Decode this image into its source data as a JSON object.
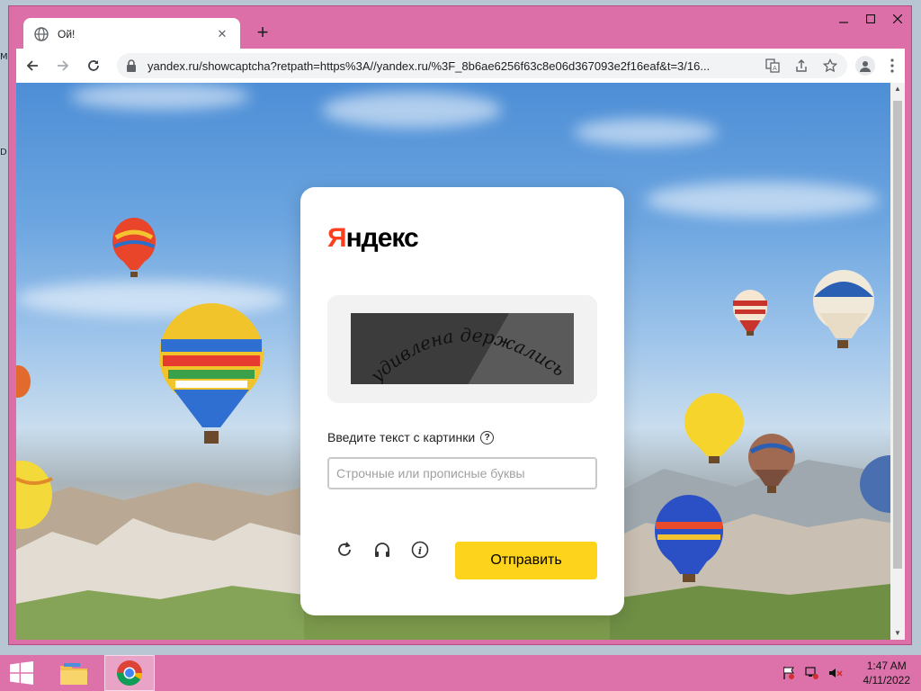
{
  "desktop": {
    "glyph_top": "M",
    "glyph_mid": "D"
  },
  "browser": {
    "tab_title": "Ой!",
    "url": "yandex.ru/showcaptcha?retpath=https%3A//yandex.ru/%3F_8b6ae6256f63c8e06d367093e2f16eaf&t=3/16..."
  },
  "captcha": {
    "logo_first": "Я",
    "logo_rest": "ндекс",
    "image_text": "удивлена держались",
    "prompt": "Введите текст с картинки",
    "input_placeholder": "Строчные или прописные буквы",
    "input_value": "",
    "submit_label": "Отправить"
  },
  "taskbar": {
    "time": "1:47 AM",
    "date": "4/11/2022"
  },
  "colors": {
    "accent": "#fdd31c",
    "logo_red": "#fc3f1d",
    "window_frame": "#dd6fa8"
  }
}
